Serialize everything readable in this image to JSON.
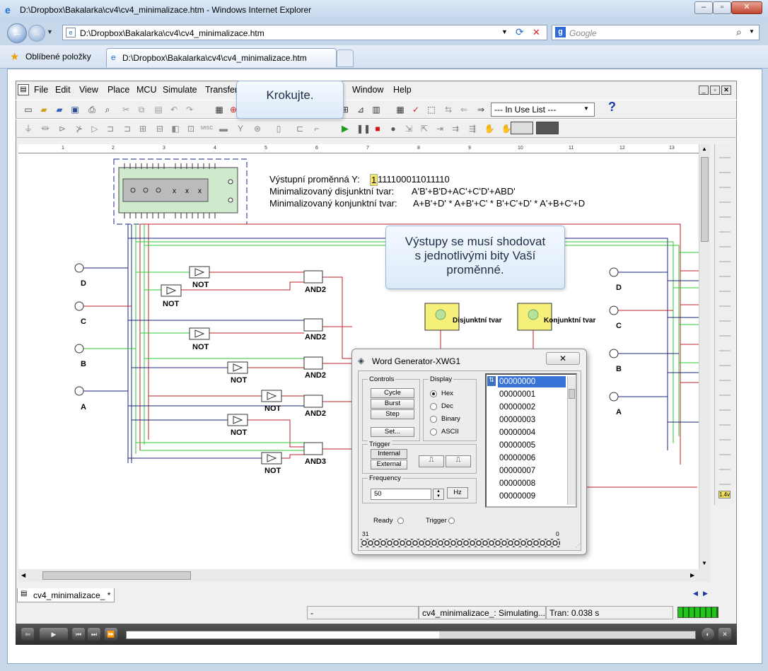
{
  "browser": {
    "title": "D:\\Dropbox\\Bakalarka\\cv4\\cv4_minimalizace.htm - Windows Internet Explorer",
    "address": "D:\\Dropbox\\Bakalarka\\cv4\\cv4_minimalizace.htm",
    "search_placeholder": "Google",
    "favorites_label": "Oblíbené položky",
    "tab_label": "D:\\Dropbox\\Bakalarka\\cv4\\cv4_minimalizace.htm"
  },
  "app": {
    "menu": [
      "File",
      "Edit",
      "View",
      "Place",
      "MCU",
      "Simulate",
      "Transfer",
      "Window",
      "Help"
    ],
    "in_use_list": "--- In Use List ---",
    "ruler": [
      "1",
      "2",
      "3",
      "4",
      "5",
      "6",
      "7",
      "8",
      "9",
      "10",
      "11",
      "12",
      "13"
    ]
  },
  "tooltips": {
    "krokujte": "Krokujte.",
    "vystupy_line1": "Výstupy se musí shodovat",
    "vystupy_line2": "s jednotlivými bity Vaší",
    "vystupy_line3": "proměnné."
  },
  "circuit": {
    "vystupni_label": "Výstupní proměnná Y:",
    "vystupni_first": "1",
    "vystupni_rest": "111100011011110",
    "disj_label": "Minimalizovaný disjunktní tvar:",
    "disj_value": "A'B'+B'D+AC'+C'D'+ABD'",
    "konj_label": "Minimalizovaný konjunktní tvar:",
    "konj_value": "A+B'+D' * A+B'+C' * B'+C'+D' * A'+B+C'+D",
    "inputs_left": [
      "D",
      "C",
      "B",
      "A"
    ],
    "inputs_right": [
      "D",
      "C",
      "B",
      "A"
    ],
    "not_label": "NOT",
    "and2_label": "AND2",
    "and3_label": "AND3",
    "disj_probe": "Disjunktní tvar",
    "konj_probe": "Konjunktní tvar"
  },
  "word_generator": {
    "title": "Word Generator-XWG1",
    "controls_label": "Controls",
    "cycle": "Cycle",
    "burst": "Burst",
    "step": "Step",
    "set": "Set...",
    "display_label": "Display",
    "display_options": [
      "Hex",
      "Dec",
      "Binary",
      "ASCII"
    ],
    "display_selected": "Hex",
    "trigger_label": "Trigger",
    "internal": "Internal",
    "external": "External",
    "frequency_label": "Frequency",
    "frequency_value": "50",
    "frequency_unit": "Hz",
    "ready": "Ready",
    "trigger": "Trigger",
    "bit_high": "31",
    "bit_low": "0",
    "words": [
      "00000000",
      "00000001",
      "00000002",
      "00000003",
      "00000004",
      "00000005",
      "00000006",
      "00000007",
      "00000008",
      "00000009"
    ]
  },
  "bottom": {
    "doc_tab": "cv4_minimalizace_ *",
    "status_1": "-",
    "status_2": "cv4_minimalizace_: Simulating...",
    "status_3": "Tran: 0.038 s"
  },
  "colors": {
    "wire_red": "#c0202a",
    "wire_green": "#2ec832",
    "wire_blue": "#1a237e",
    "probe_yellow": "#f5f07a"
  }
}
